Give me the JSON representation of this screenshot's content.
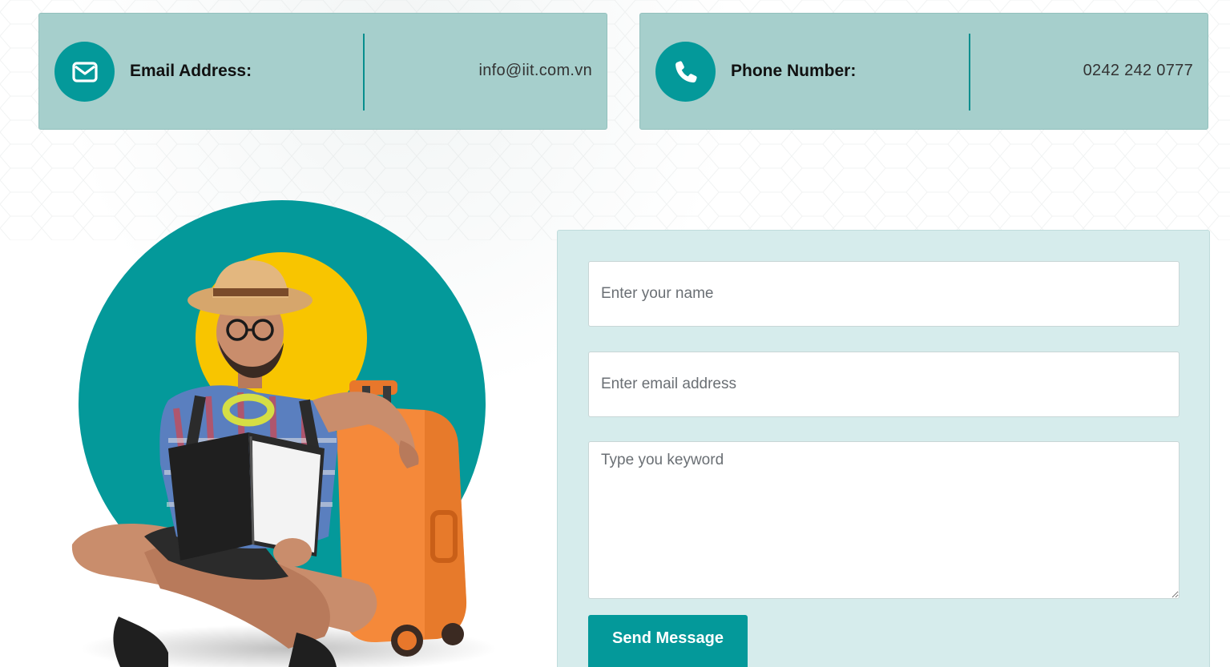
{
  "contact": {
    "email": {
      "label": "Email Address:",
      "value": "info@iit.com.vn",
      "icon": "envelope-icon"
    },
    "phone": {
      "label": "Phone Number:",
      "value": "0242 242 0777",
      "icon": "phone-icon"
    }
  },
  "form": {
    "name_placeholder": "Enter your name",
    "email_placeholder": "Enter email address",
    "message_placeholder": "Type you keyword",
    "submit_label": "Send Message"
  },
  "colors": {
    "accent": "#04999a",
    "card_bg": "#a6cfcc",
    "form_bg": "#d6ecec",
    "sun": "#f8c500",
    "suitcase": "#f5893a"
  }
}
